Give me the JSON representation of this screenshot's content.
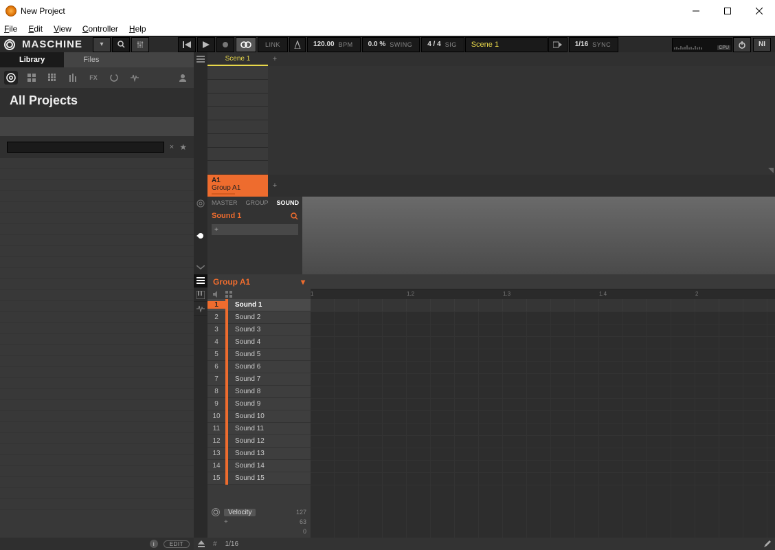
{
  "window": {
    "title": "New Project"
  },
  "menubar": [
    "File",
    "Edit",
    "View",
    "Controller",
    "Help"
  ],
  "brand": "MASCHINE",
  "transport": {
    "link": "LINK",
    "bpm_value": "120.00",
    "bpm_label": "BPM",
    "swing_value": "0.0 %",
    "swing_label": "SWING",
    "sig_value": "4 / 4",
    "sig_label": "SIG",
    "scene": "Scene 1",
    "grid": "1/16",
    "sync": "SYNC",
    "cpu": "CPU"
  },
  "browser": {
    "tabs": {
      "library": "Library",
      "files": "Files"
    },
    "heading": "All Projects"
  },
  "editbtn": "EDIT",
  "scene_tab": "Scene 1",
  "group": {
    "id": "A1",
    "name": "Group A1"
  },
  "mgs": {
    "master": "MASTER",
    "group": "GROUP",
    "sound": "SOUND"
  },
  "selected_sound": "Sound 1",
  "pattern_group": "Group A1",
  "sounds": [
    "Sound 1",
    "Sound 2",
    "Sound 3",
    "Sound 4",
    "Sound 5",
    "Sound 6",
    "Sound 7",
    "Sound 8",
    "Sound 9",
    "Sound 10",
    "Sound 11",
    "Sound 12",
    "Sound 13",
    "Sound 14",
    "Sound 15"
  ],
  "velocity": {
    "label": "Velocity",
    "max": "127",
    "mid": "63",
    "min": "0"
  },
  "ruler_ticks": [
    {
      "pos": 0,
      "label": "1"
    },
    {
      "pos": 140,
      "label": "1.2"
    },
    {
      "pos": 280,
      "label": "1.3"
    },
    {
      "pos": 420,
      "label": "1.4"
    },
    {
      "pos": 560,
      "label": "2"
    }
  ],
  "bottom_grid": "1/16"
}
